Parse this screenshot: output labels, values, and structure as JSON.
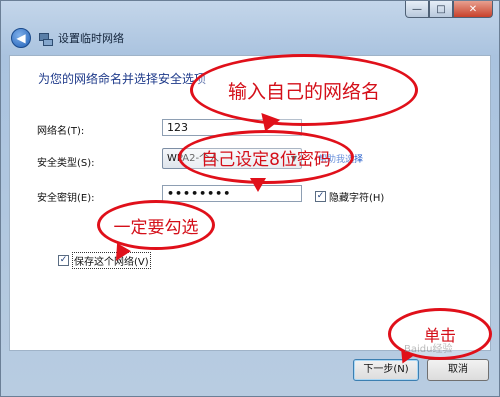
{
  "window": {
    "title": "设置临时网络",
    "sys_buttons": {
      "minimize": "—",
      "maximize": "□",
      "close": "✕"
    },
    "back_icon": "back-arrow-icon"
  },
  "form": {
    "heading": "为您的网络命名并选择安全选项",
    "network_name_label": "网络名(T):",
    "network_name_value": "123",
    "security_type_label": "安全类型(S):",
    "security_type_value": "WPA2-个人",
    "help_link": "帮助我选择",
    "security_key_label": "安全密钥(E):",
    "security_key_value": "••••••••",
    "hide_chars_label": "隐藏字符(H)",
    "hide_chars_checked": true,
    "save_network_label": "保存这个网络(V)",
    "save_network_checked": true
  },
  "buttons": {
    "next": "下一步(N)",
    "cancel": "取消"
  },
  "annotations": {
    "enter_name": "输入自己的网络名",
    "set_password": "自己设定8位密码",
    "must_check": "一定要勾选",
    "click": "单击",
    "color": "#e0101a"
  },
  "watermark": "Baidu经验"
}
